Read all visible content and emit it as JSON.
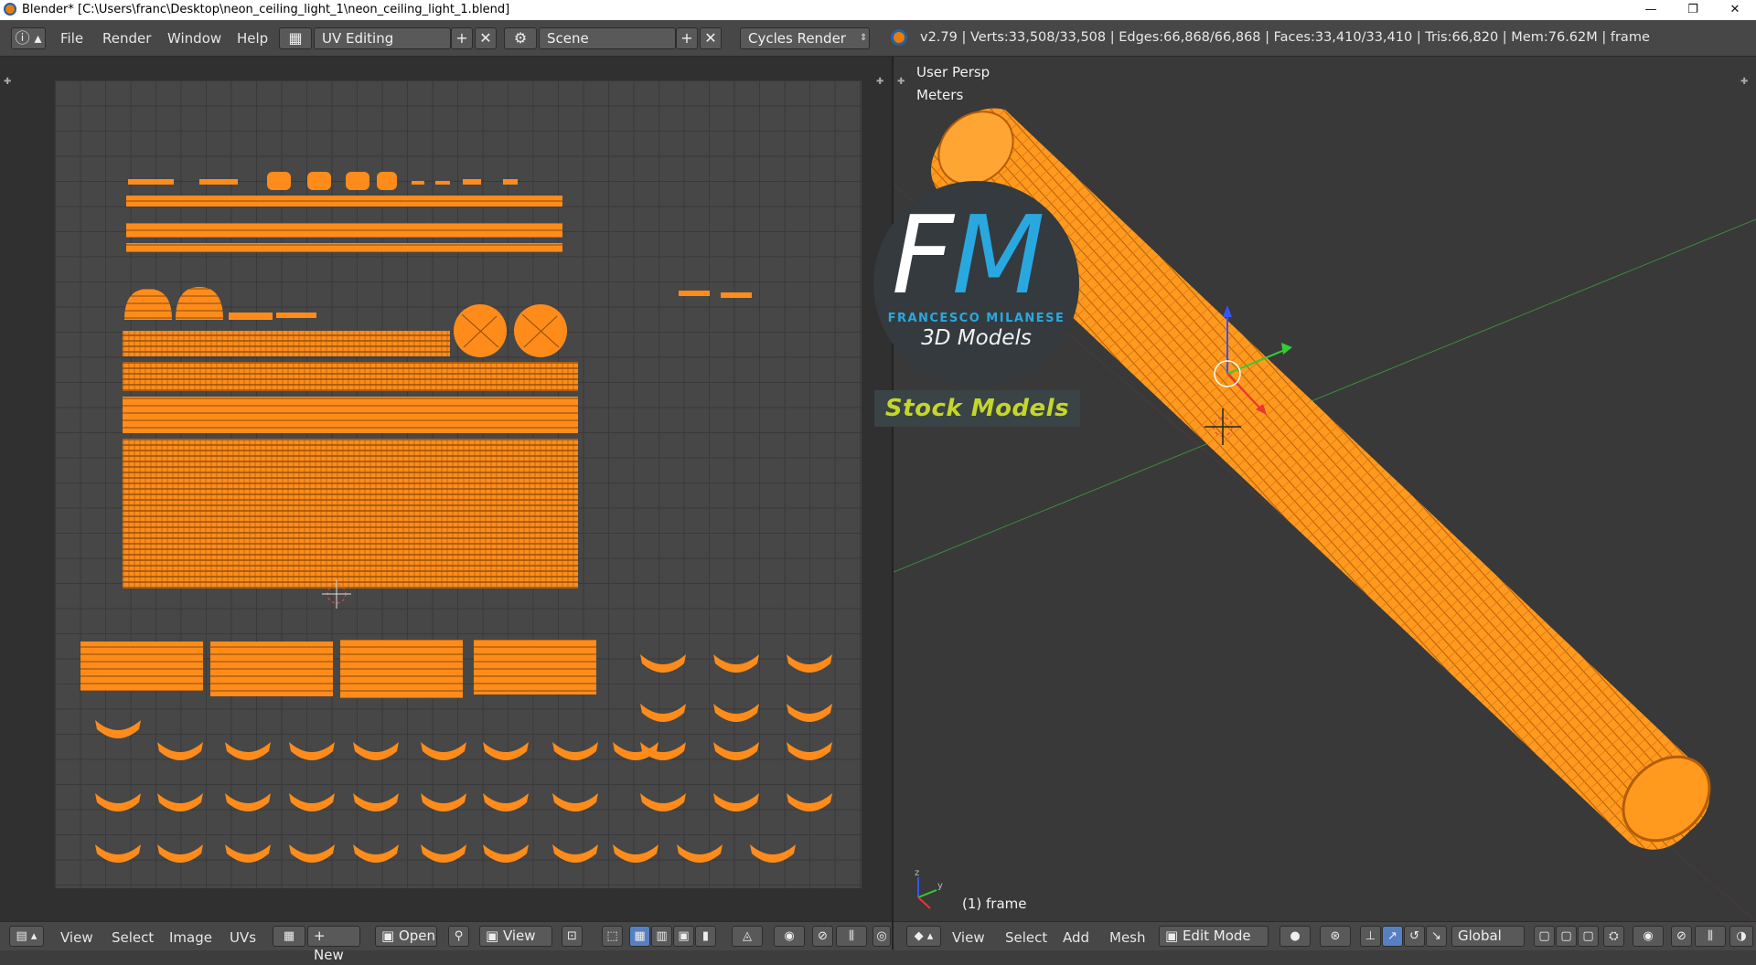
{
  "window": {
    "title": "Blender* [C:\\Users\\franc\\Desktop\\neon_ceiling_light_1\\neon_ceiling_light_1.blend]",
    "minimize": "—",
    "maximize": "❐",
    "close": "✕"
  },
  "info_header": {
    "menus": [
      "File",
      "Render",
      "Window",
      "Help"
    ],
    "screen_layout": "UV Editing",
    "scene": "Scene",
    "render_engine": "Cycles Render",
    "stats": "v2.79 | Verts:33,508/33,508 | Edges:66,868/66,868 | Faces:33,410/33,410 | Tris:66,820 | Mem:76.62M | frame"
  },
  "viewport": {
    "view_name": "User Persp",
    "units": "Meters",
    "object_label": "(1) frame",
    "mode": "Edit Mode",
    "orientation": "Global"
  },
  "uv_header": {
    "menus": [
      "View",
      "Select",
      "Image",
      "UVs"
    ],
    "new_label": "New",
    "open_label": "Open",
    "view_label": "View"
  },
  "viewport_header": {
    "menus": [
      "View",
      "Select",
      "Add",
      "Mesh"
    ]
  },
  "logo": {
    "letters_f": "F",
    "letters_m": "M",
    "name": "FRANCESCO MILANESE",
    "subtitle": "3D Models",
    "banner": "Stock Models"
  },
  "colors": {
    "uv_orange": "#ff8c1a",
    "mesh_orange": "#ff9a1f",
    "logo_blue": "#29a8e0",
    "banner_yellow": "#c5d62a"
  }
}
